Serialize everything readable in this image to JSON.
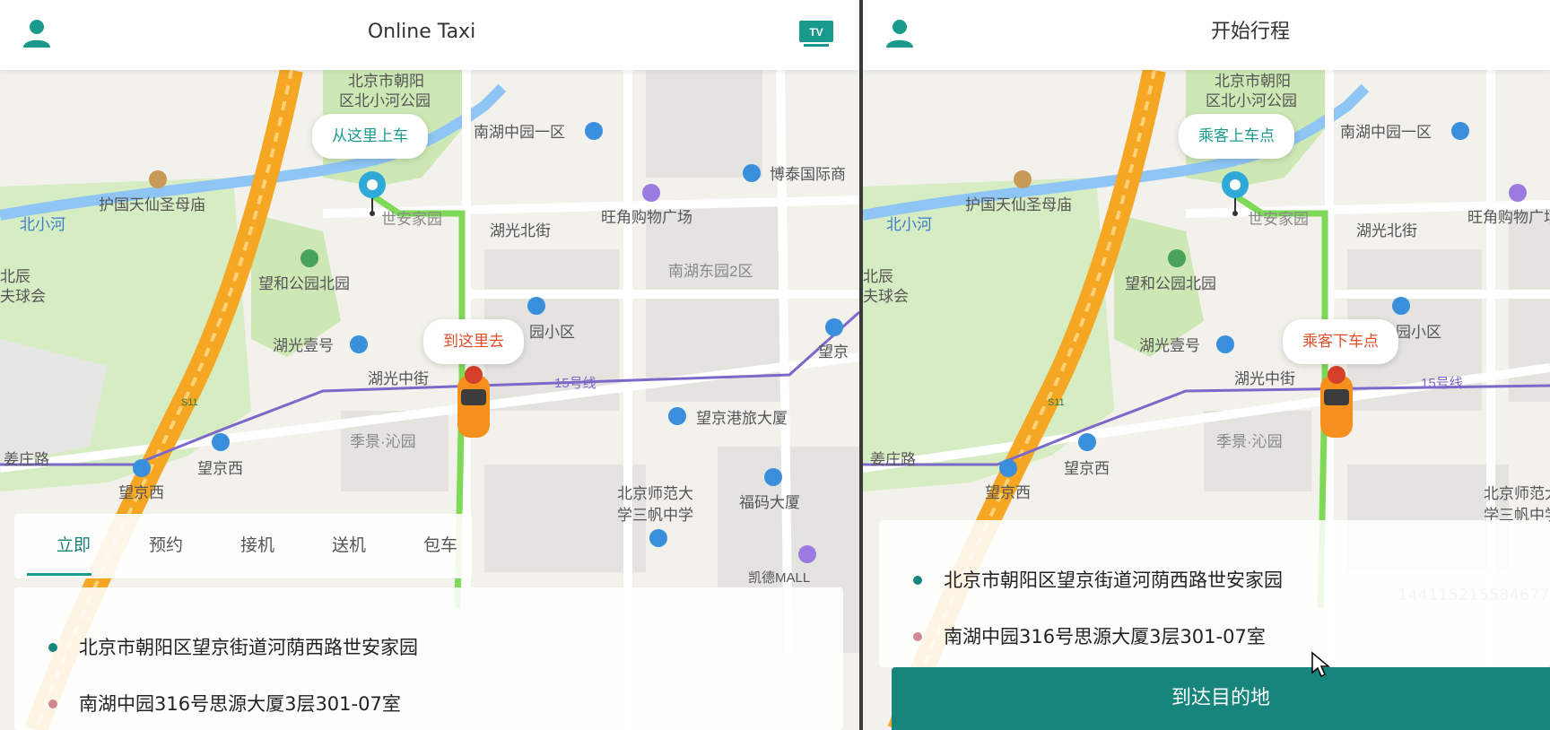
{
  "left": {
    "title": "Online Taxi",
    "tv_label": "TV",
    "pickup_bubble": "从这里上车",
    "dropoff_bubble": "到这里去",
    "tabs": [
      {
        "label": "立即",
        "active": true
      },
      {
        "label": "预约",
        "active": false
      },
      {
        "label": "接机",
        "active": false
      },
      {
        "label": "送机",
        "active": false
      },
      {
        "label": "包车",
        "active": false
      }
    ],
    "start_address": "北京市朝阳区望京街道河荫西路世安家园",
    "end_address": "南湖中园316号思源大厦3层301-07室"
  },
  "right": {
    "title": "开始行程",
    "pickup_bubble": "乘客上车点",
    "dropoff_bubble": "乘客下车点",
    "start_address": "北京市朝阳区望京街道河荫西路世安家园",
    "end_address": "南湖中园316号思源大厦3层301-07室",
    "arrive_button": "到达目的地",
    "overlay_number": "144115215584677"
  },
  "map_labels": {
    "park": "北京市朝阳区北小河公园",
    "park_line1": "北京市朝阳",
    "park_line2": "区北小河公园",
    "nanhu_1": "南湖中园一区",
    "botai": "博泰国际商",
    "church": "护国天仙圣母庙",
    "river": "北小河",
    "wangjiao": "旺角购物广场",
    "shian": "世安家园",
    "huguang_north": "湖光北街",
    "nanhu_east2": "南湖东园2区",
    "beichen_1": "北辰",
    "beichen_2": "夫球会",
    "wanghe_park": "望和公园北园",
    "huguang_one": "湖光壹号",
    "huguang_mid": "湖光中街",
    "yuan_xiaoqu": "园小区",
    "line15": "15号线",
    "wangjing_gang": "望京港旅大厦",
    "wangjing": "望京",
    "jiangzhuang": "姜庄路",
    "wangjingxi": "望京西",
    "jiyuan": "季景·沁园",
    "bnu_1": "北京师范大",
    "bnu_2": "学三帆中学",
    "fuma": "福码大厦",
    "kaide": "凯德MALL",
    "s11": "S11"
  },
  "colors": {
    "accent": "#1a9a8c",
    "button": "#17857b",
    "route": "#7ed957",
    "highway": "#f5a623",
    "subway": "#7b68c8",
    "river": "#8ec5f5",
    "park": "#cde8b5"
  },
  "icons": {
    "user": "user-icon",
    "tv": "tv-icon",
    "car": "car-icon",
    "pin": "location-pin-icon",
    "cursor": "mouse-cursor-icon"
  }
}
